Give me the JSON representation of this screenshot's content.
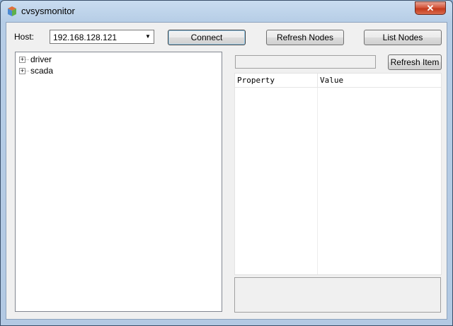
{
  "window": {
    "title": "cvsysmonitor",
    "close_label": "✕"
  },
  "host": {
    "label": "Host:",
    "value": "192.168.128.121"
  },
  "buttons": {
    "connect": "Connect",
    "refresh_nodes": "Refresh Nodes",
    "list_nodes": "List Nodes",
    "refresh_item": "Refresh Item"
  },
  "tree": {
    "items": [
      {
        "label": "driver"
      },
      {
        "label": "scada"
      }
    ]
  },
  "properties": {
    "columns": [
      "Property",
      "Value"
    ]
  },
  "colors": {
    "accent": "#c33a1d",
    "window_frame": "#b6cde6",
    "client_bg": "#f0f0f0"
  },
  "icons": {
    "app": "cube-app-icon",
    "expander": "plus-expander-icon",
    "dropdown": "chevron-down-icon",
    "close": "close-icon"
  }
}
